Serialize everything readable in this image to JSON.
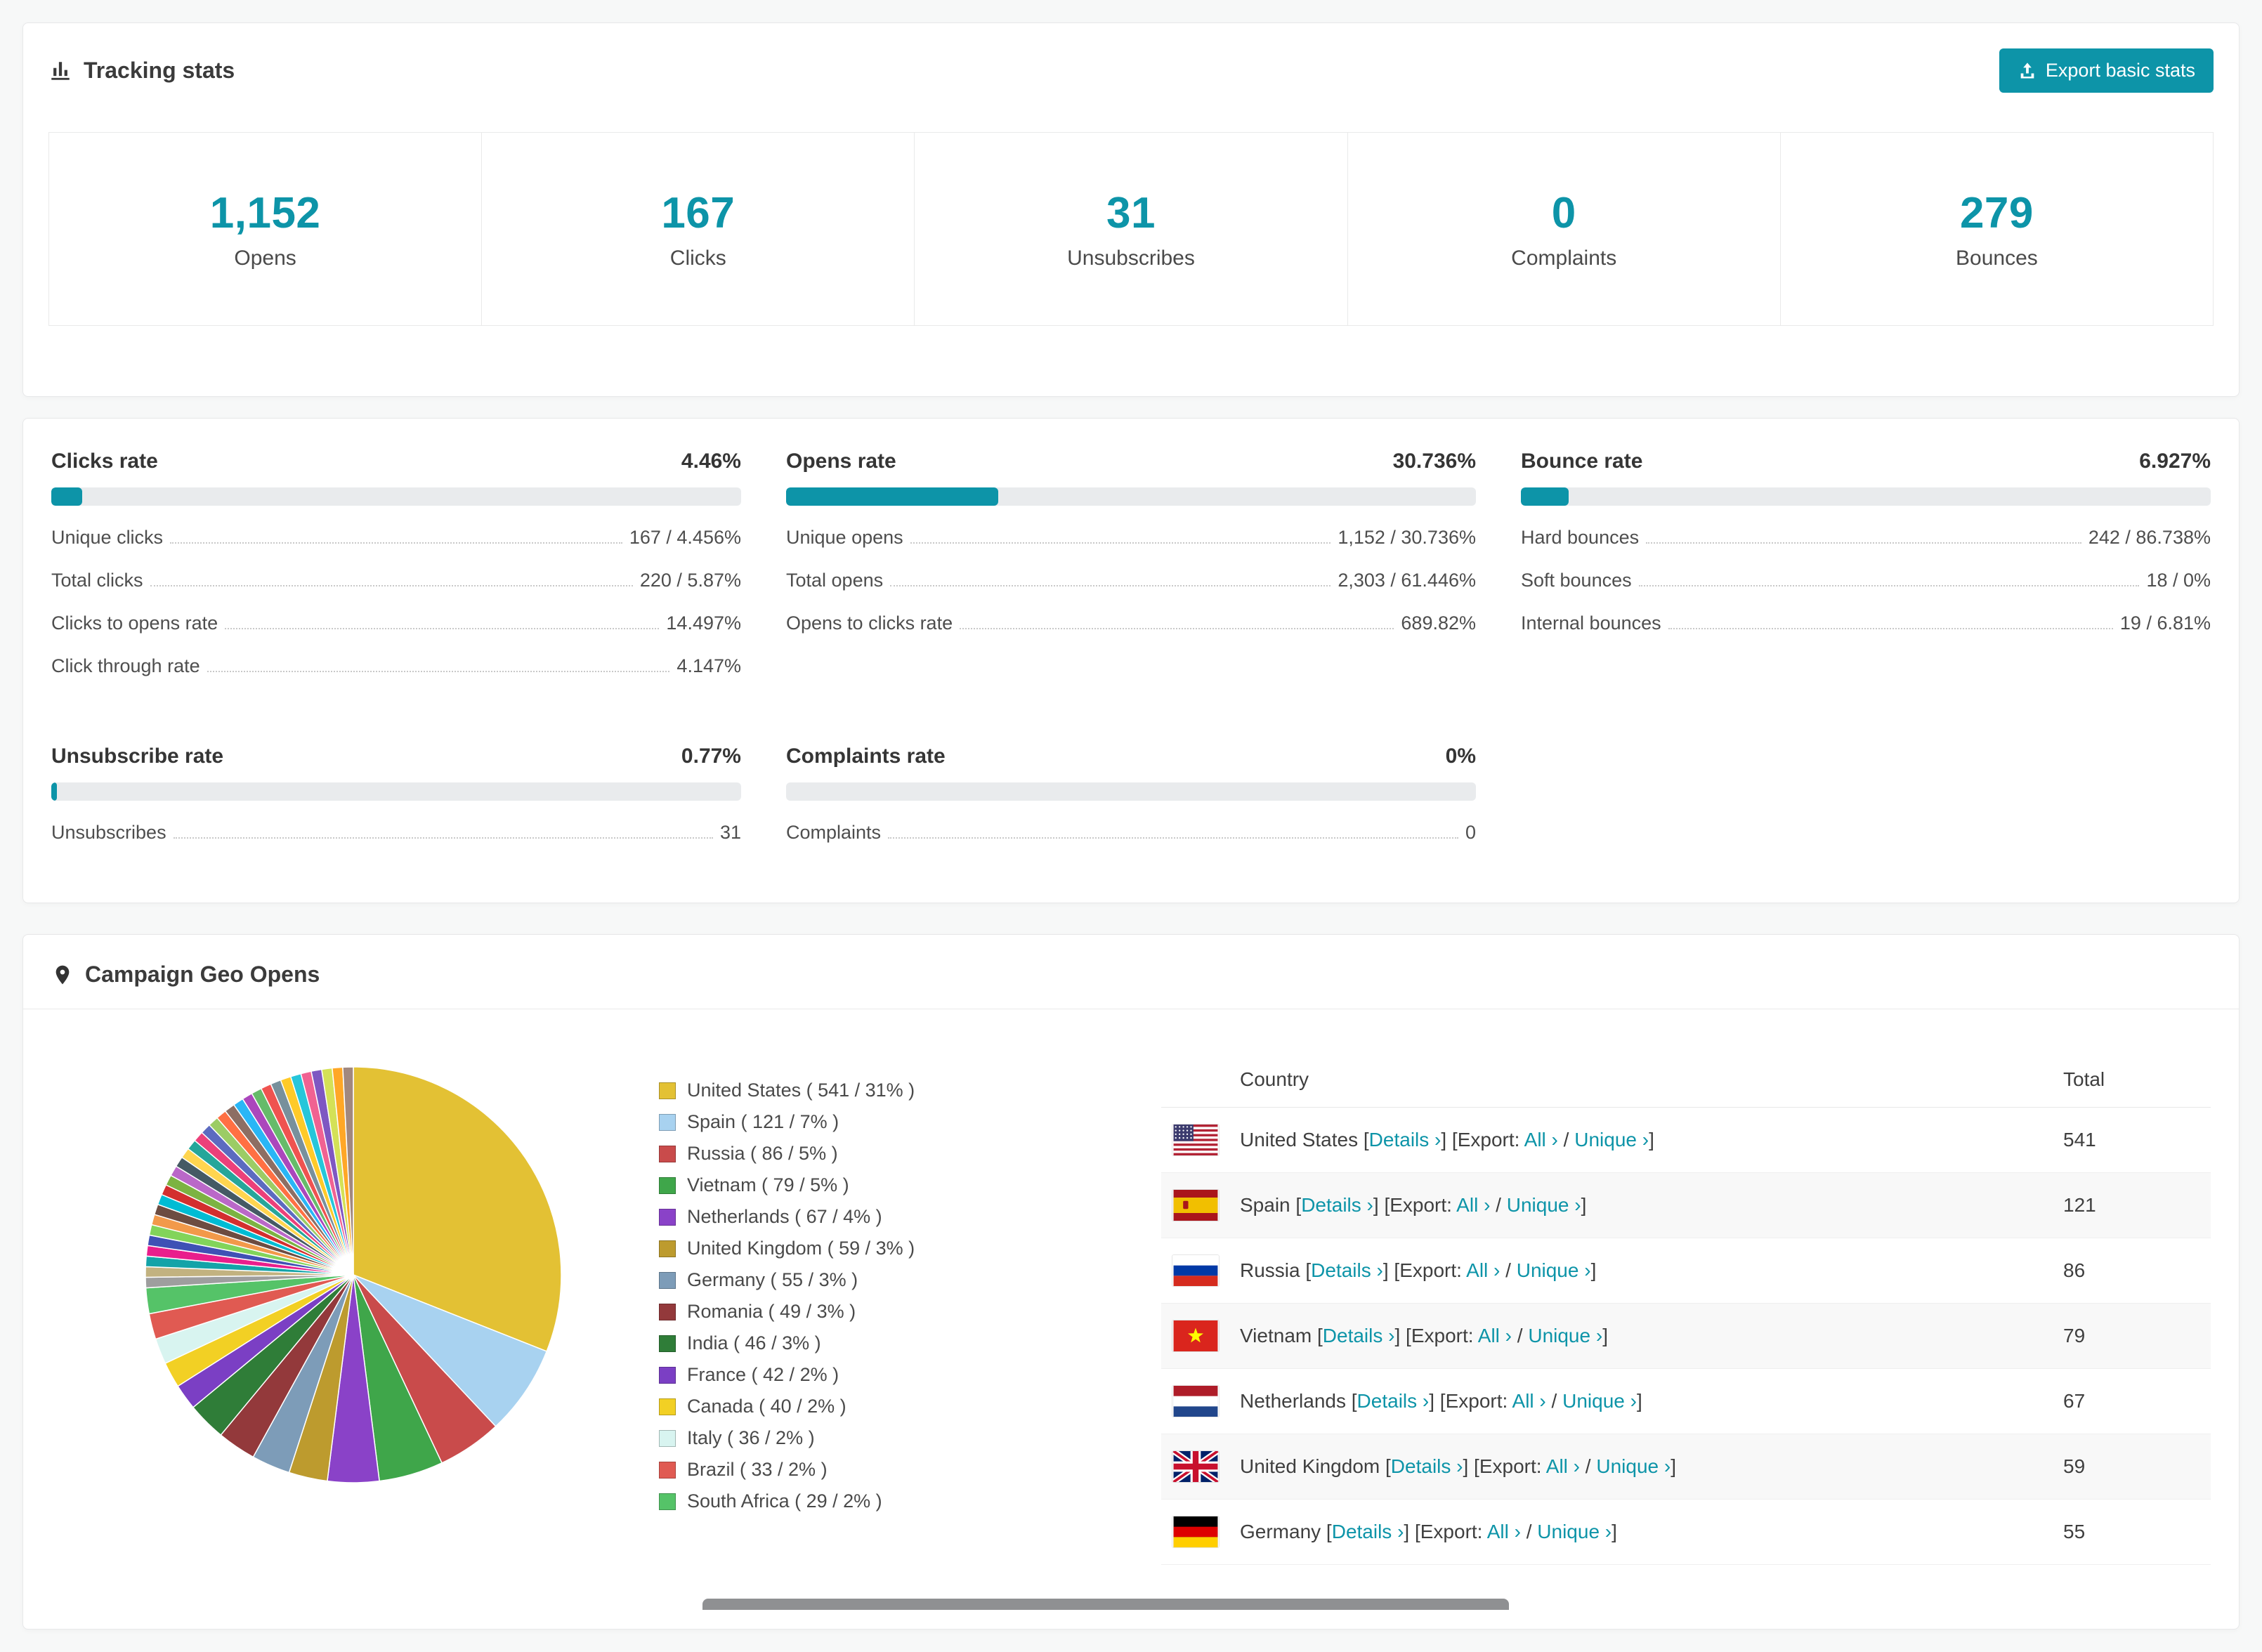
{
  "theme": {
    "accent": "#0D94A8",
    "accent_text": "#FFFFFF"
  },
  "tracking": {
    "title": "Tracking stats",
    "export_button": "Export basic stats",
    "stats": [
      {
        "value": "1,152",
        "label": "Opens"
      },
      {
        "value": "167",
        "label": "Clicks"
      },
      {
        "value": "31",
        "label": "Unsubscribes"
      },
      {
        "value": "0",
        "label": "Complaints"
      },
      {
        "value": "279",
        "label": "Bounces"
      }
    ]
  },
  "rates": [
    {
      "title": "Clicks rate",
      "value": "4.46%",
      "percent": 4.46,
      "rows": [
        {
          "label": "Unique clicks",
          "value": "167 / 4.456%"
        },
        {
          "label": "Total clicks",
          "value": "220 / 5.87%"
        },
        {
          "label": "Clicks to opens rate",
          "value": "14.497%"
        },
        {
          "label": "Click through rate",
          "value": "4.147%"
        }
      ]
    },
    {
      "title": "Opens rate",
      "value": "30.736%",
      "percent": 30.736,
      "rows": [
        {
          "label": "Unique opens",
          "value": "1,152 / 30.736%"
        },
        {
          "label": "Total opens",
          "value": "2,303 / 61.446%"
        },
        {
          "label": "Opens to clicks rate",
          "value": "689.82%"
        }
      ]
    },
    {
      "title": "Bounce rate",
      "value": "6.927%",
      "percent": 6.927,
      "rows": [
        {
          "label": "Hard bounces",
          "value": "242 / 86.738%"
        },
        {
          "label": "Soft bounces",
          "value": "18 / 0%"
        },
        {
          "label": "Internal bounces",
          "value": "19 / 6.81%"
        }
      ]
    },
    {
      "title": "Unsubscribe rate",
      "value": "0.77%",
      "percent": 0.77,
      "rows": [
        {
          "label": "Unsubscribes",
          "value": "31"
        }
      ]
    },
    {
      "title": "Complaints rate",
      "value": "0%",
      "percent": 0,
      "rows": [
        {
          "label": "Complaints",
          "value": "0"
        }
      ]
    }
  ],
  "geo": {
    "title": "Campaign Geo Opens",
    "table": {
      "headers": [
        "Country",
        "Total"
      ],
      "details_label": "Details ›",
      "export_label": "[Export:",
      "all_label": "All ›",
      "unique_label": "Unique ›",
      "rows": [
        {
          "country": "United States",
          "total": "541",
          "flag": "us"
        },
        {
          "country": "Spain",
          "total": "121",
          "flag": "es"
        },
        {
          "country": "Russia",
          "total": "86",
          "flag": "ru"
        },
        {
          "country": "Vietnam",
          "total": "79",
          "flag": "vn"
        },
        {
          "country": "Netherlands",
          "total": "67",
          "flag": "nl"
        },
        {
          "country": "United Kingdom",
          "total": "59",
          "flag": "gb"
        },
        {
          "country": "Germany",
          "total": "55",
          "flag": "de"
        }
      ]
    }
  },
  "chart_data": {
    "type": "pie",
    "title": "Campaign Geo Opens",
    "unit": "opens",
    "legend_position": "right",
    "slices": [
      {
        "label": "United States",
        "count": 541,
        "percent": 31,
        "color": "#E3C134"
      },
      {
        "label": "Spain",
        "count": 121,
        "percent": 7,
        "color": "#A8D2F0"
      },
      {
        "label": "Russia",
        "count": 86,
        "percent": 5,
        "color": "#C94B4B"
      },
      {
        "label": "Vietnam",
        "count": 79,
        "percent": 5,
        "color": "#3FA64A"
      },
      {
        "label": "Netherlands",
        "count": 67,
        "percent": 4,
        "color": "#8A42C8"
      },
      {
        "label": "United Kingdom",
        "count": 59,
        "percent": 3,
        "color": "#BD9B2E"
      },
      {
        "label": "Germany",
        "count": 55,
        "percent": 3,
        "color": "#7D9CB8"
      },
      {
        "label": "Romania",
        "count": 49,
        "percent": 3,
        "color": "#93393B"
      },
      {
        "label": "India",
        "count": 46,
        "percent": 3,
        "color": "#2F7D38"
      },
      {
        "label": "France",
        "count": 42,
        "percent": 2,
        "color": "#7B3FC4"
      },
      {
        "label": "Canada",
        "count": 40,
        "percent": 2,
        "color": "#F2D024"
      },
      {
        "label": "Italy",
        "count": 36,
        "percent": 2,
        "color": "#D8F4F0"
      },
      {
        "label": "Brazil",
        "count": 33,
        "percent": 2,
        "color": "#E05A52"
      },
      {
        "label": "South Africa",
        "count": 29,
        "percent": 2,
        "color": "#55C368"
      }
    ],
    "other_slices": {
      "note": "many small unlabeled country slices",
      "total_percent": 26,
      "colors": [
        "#9E9E9E",
        "#C2B280",
        "#14A3A8",
        "#E91E8C",
        "#3F51B5",
        "#82D45A",
        "#F2994A",
        "#6D4C41",
        "#00BCD4",
        "#D32F2F",
        "#7CB342",
        "#BA68C8",
        "#455A64",
        "#FFD54F",
        "#26A69A",
        "#EC407A",
        "#5C6BC0",
        "#9CCC65",
        "#FF7043",
        "#8D6E63",
        "#29B6F6",
        "#AB47BC",
        "#66BB6A",
        "#EF5350",
        "#78909C",
        "#FFCA28",
        "#26C6DA",
        "#F06292",
        "#7E57C2",
        "#D4E157",
        "#FFA726",
        "#A1887F"
      ]
    }
  }
}
